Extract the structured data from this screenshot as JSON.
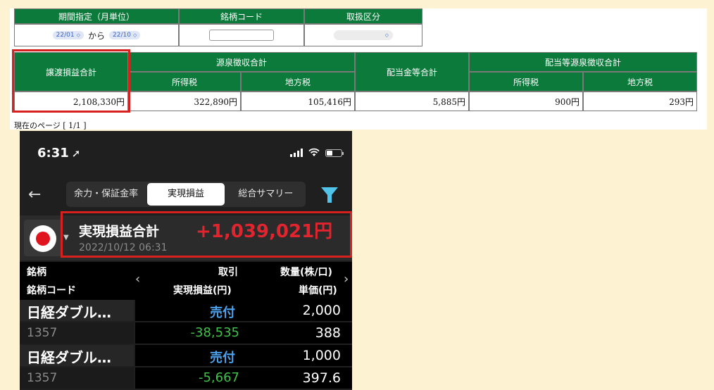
{
  "web": {
    "filter_headers": [
      "期間指定（月単位）",
      "銘柄コード",
      "取扱区分"
    ],
    "period_from": "22/01",
    "period_connector": "から",
    "period_to": "22/10",
    "stock_code_value": "",
    "category_value": "",
    "summary_headers": {
      "transfer_pl_total": "譲渡損益合計",
      "withholding_total": "源泉徴収合計",
      "income_tax": "所得税",
      "local_tax": "地方税",
      "dividend_total": "配当金等合計",
      "dividend_withholding_total": "配当等源泉徴収合計",
      "dividend_income_tax": "所得税",
      "dividend_local_tax": "地方税"
    },
    "summary_values": {
      "transfer_pl_total": "2,108,330円",
      "income_tax": "322,890円",
      "local_tax": "105,416円",
      "dividend_total": "5,885円",
      "dividend_income_tax": "900円",
      "dividend_local_tax": "293円"
    },
    "page_indicator": "現在のページ [ 1/1 ]"
  },
  "phone": {
    "status_time": "6:31",
    "tabs": [
      "余力・保証金率",
      "実現損益",
      "総合サマリー"
    ],
    "active_tab": "実現損益",
    "summary_title": "実現損益合計",
    "summary_value": "+1,039,021円",
    "summary_date": "2022/10/12 06:31",
    "columns": {
      "name": "銘柄",
      "code": "銘柄コード",
      "trade": "取引",
      "pl": "実現損益(円)",
      "qty": "数量(株/口)",
      "price": "単価(円)"
    },
    "rows": [
      {
        "name": "日経ダブル…",
        "code": "1357",
        "trade": "売付",
        "pl": "-38,535",
        "qty": "2,000",
        "price": "388"
      },
      {
        "name": "日経ダブル…",
        "code": "1357",
        "trade": "売付",
        "pl": "-5,667",
        "qty": "1,000",
        "price": "397.6"
      }
    ],
    "colors": {
      "profit_red": "#e2242e",
      "loss_green": "#3fc24a",
      "sell_blue": "#4aa3ec",
      "header_green": "#0b7a3b",
      "highlight_red": "#d8201f"
    },
    "icons": [
      "location-arrow-icon",
      "signal-icon",
      "wifi-icon",
      "battery-icon",
      "back-arrow-icon",
      "filter-icon",
      "japan-flag-icon",
      "chevron-left-icon",
      "chevron-right-icon"
    ]
  }
}
